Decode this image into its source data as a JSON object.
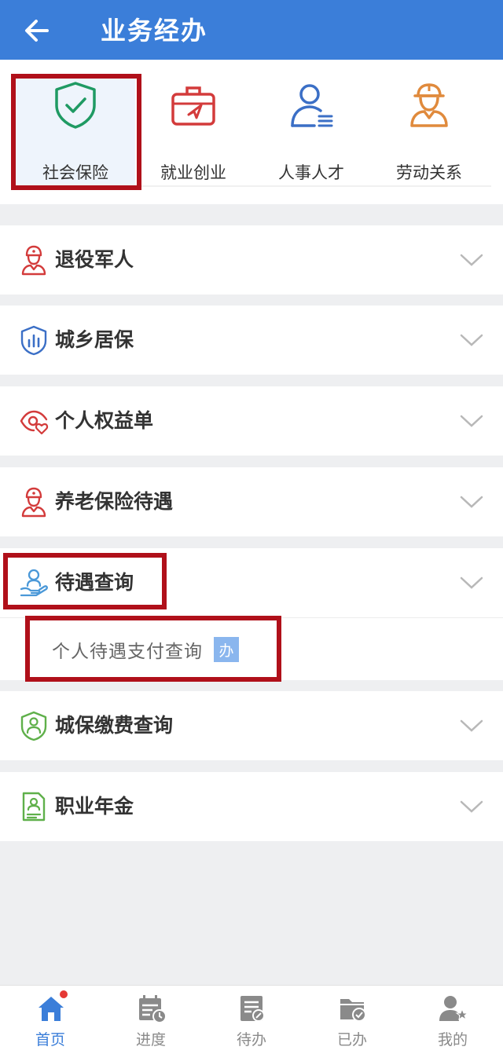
{
  "header": {
    "title": "业务经办"
  },
  "categories": [
    {
      "label": "社会保险",
      "icon": "shield-check-icon",
      "color": "#1f9a63"
    },
    {
      "label": "就业创业",
      "icon": "briefcase-icon",
      "color": "#d33b3b"
    },
    {
      "label": "人事人才",
      "icon": "person-list-icon",
      "color": "#3b6fc6"
    },
    {
      "label": "劳动关系",
      "icon": "worker-icon",
      "color": "#e08a3c"
    }
  ],
  "sections": [
    {
      "label": "退役军人",
      "icon": "soldier-icon"
    },
    {
      "label": "城乡居保",
      "icon": "chart-shield-icon"
    },
    {
      "label": "个人权益单",
      "icon": "eye-heart-icon"
    },
    {
      "label": "养老保险待遇",
      "icon": "soldier-icon"
    },
    {
      "label": "待遇查询",
      "icon": "hand-person-icon",
      "expanded": true,
      "items": [
        {
          "label": "个人待遇支付查询",
          "badge": "办"
        }
      ]
    },
    {
      "label": "城保缴费查询",
      "icon": "person-shield-icon"
    },
    {
      "label": "职业年金",
      "icon": "document-person-icon"
    }
  ],
  "tabbar": {
    "items": [
      {
        "label": "首页",
        "icon": "home-icon",
        "active": true
      },
      {
        "label": "进度",
        "icon": "calendar-clock-icon"
      },
      {
        "label": "待办",
        "icon": "document-pen-icon"
      },
      {
        "label": "已办",
        "icon": "folder-check-icon"
      },
      {
        "label": "我的",
        "icon": "user-star-icon"
      }
    ]
  },
  "colors": {
    "header": "#3b7ed9",
    "highlight": "#b0101a",
    "badge": "#8ab6ee"
  }
}
